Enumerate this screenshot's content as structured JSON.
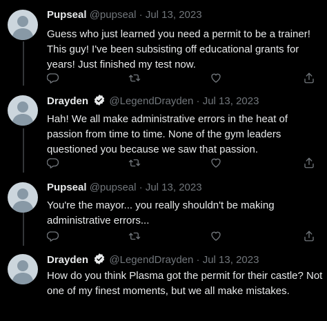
{
  "tweets": [
    {
      "name": "Pupseal",
      "handle": "@pupseal",
      "dot": "·",
      "date": "Jul 13, 2023",
      "verified": false,
      "text": "Guess who just learned you need a permit to be a trainer! This guy! I've been subsisting off educational grants for years! Just finished my test now."
    },
    {
      "name": "Drayden",
      "handle": "@LegendDrayden",
      "dot": "·",
      "date": "Jul 13, 2023",
      "verified": true,
      "text": "Hah! We all make administrative errors in the heat of passion from time to time. None of the gym leaders questioned you because we saw that passion."
    },
    {
      "name": "Pupseal",
      "handle": "@pupseal",
      "dot": "·",
      "date": "Jul 13, 2023",
      "verified": false,
      "text": "You're the mayor... you really shouldn't be making administrative errors..."
    },
    {
      "name": "Drayden",
      "handle": "@LegendDrayden",
      "dot": "·",
      "date": "Jul 13, 2023",
      "verified": true,
      "text": "How do you think Plasma got the permit for their castle? Not one of my finest moments, but we all make mistakes."
    }
  ],
  "icons": {
    "reply": "reply-icon",
    "retweet": "retweet-icon",
    "like": "like-icon",
    "share": "share-icon",
    "verified": "verified-badge-icon"
  },
  "colors": {
    "background": "#000000",
    "text": "#e7e9ea",
    "secondary": "#71767b",
    "thread_line": "#333639",
    "avatar_bg": "#ccd6dd",
    "avatar_fg": "#8899a6"
  }
}
